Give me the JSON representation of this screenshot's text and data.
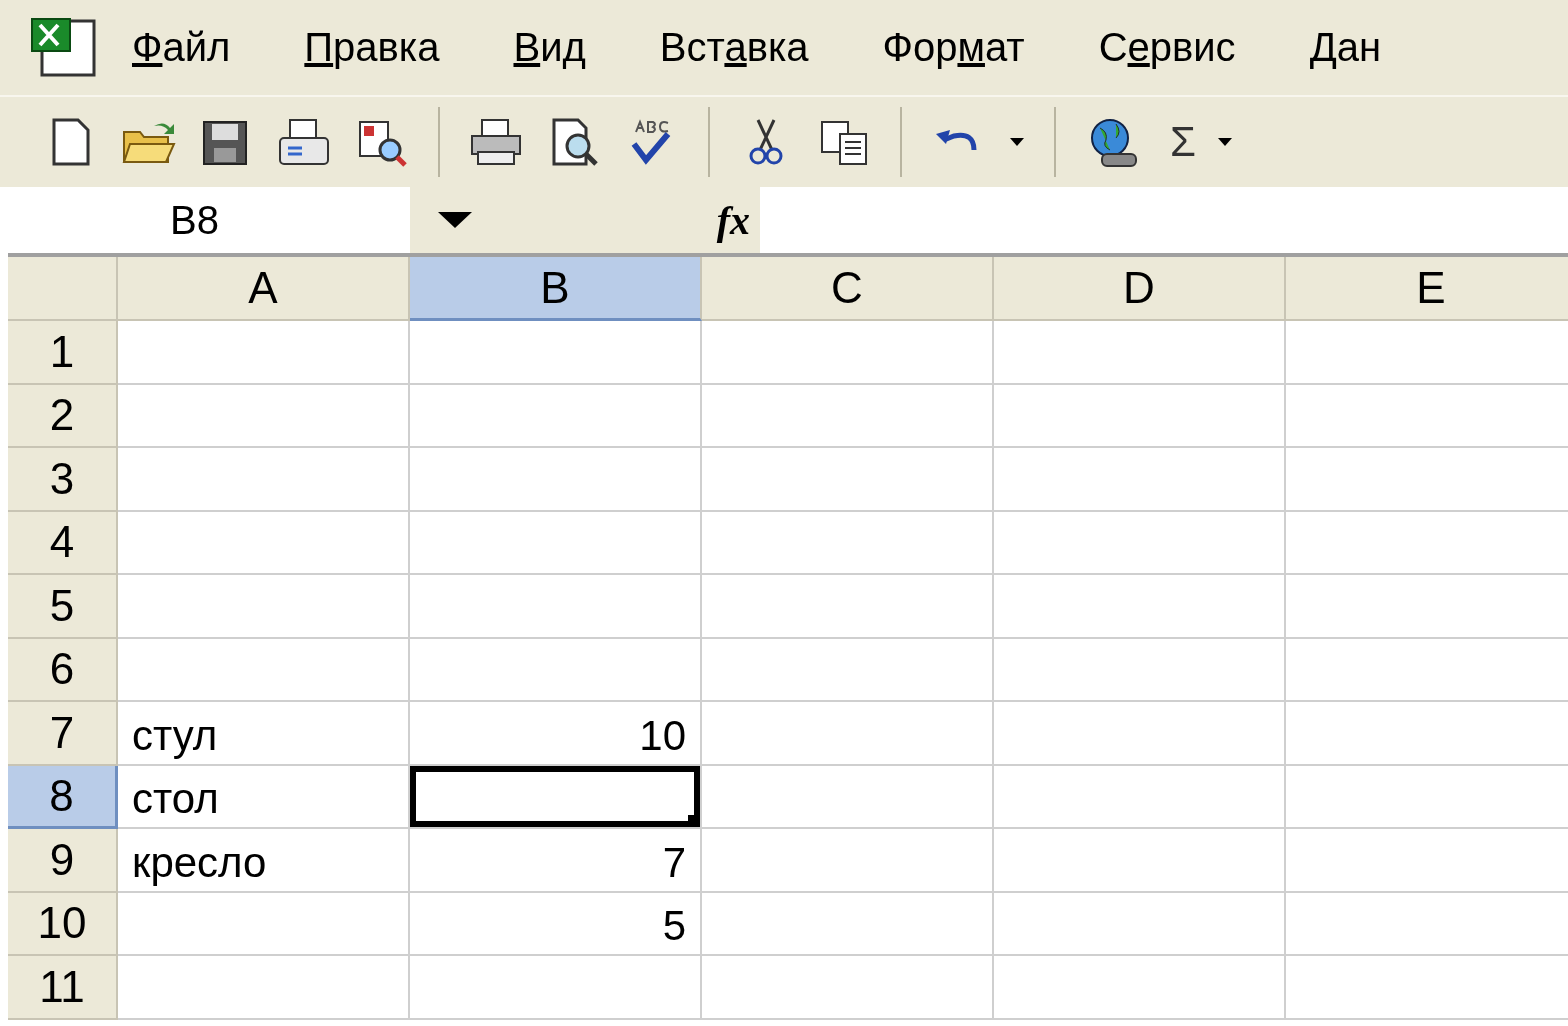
{
  "menu": [
    {
      "key": "Ф",
      "after": "айл"
    },
    {
      "key": "П",
      "after": "равка"
    },
    {
      "key": "В",
      "after": "ид"
    },
    {
      "before": "Вст",
      "key": "а",
      "after": "вка"
    },
    {
      "before": "Фор",
      "key": "м",
      "after": "ат"
    },
    {
      "before": "С",
      "key": "е",
      "after": "рвис"
    },
    {
      "before": "Дан"
    }
  ],
  "toolbar": [
    {
      "kind": "new"
    },
    {
      "kind": "open"
    },
    {
      "kind": "save"
    },
    {
      "kind": "mail"
    },
    {
      "kind": "research"
    },
    {
      "kind": "separator"
    },
    {
      "kind": "print"
    },
    {
      "kind": "preview"
    },
    {
      "kind": "spell"
    },
    {
      "kind": "separator"
    },
    {
      "kind": "cut"
    },
    {
      "kind": "copy"
    },
    {
      "kind": "separator"
    },
    {
      "kind": "undo"
    },
    {
      "kind": "caret"
    },
    {
      "kind": "separator"
    },
    {
      "kind": "globe"
    },
    {
      "kind": "sum",
      "text": "Σ"
    },
    {
      "kind": "caret"
    }
  ],
  "formula_bar": {
    "name_box": "B8",
    "fx": "fx"
  },
  "columns": [
    {
      "label": "A",
      "selected": false
    },
    {
      "label": "B",
      "selected": true
    },
    {
      "label": "C",
      "selected": false
    },
    {
      "label": "D",
      "selected": false
    },
    {
      "label": "E",
      "selected": false
    }
  ],
  "rows": [
    {
      "label": "1",
      "selected": false
    },
    {
      "label": "2",
      "selected": false
    },
    {
      "label": "3",
      "selected": false
    },
    {
      "label": "4",
      "selected": false
    },
    {
      "label": "5",
      "selected": false
    },
    {
      "label": "6",
      "selected": false
    },
    {
      "label": "7",
      "selected": false,
      "a": "стул",
      "b": "10"
    },
    {
      "label": "8",
      "selected": true,
      "a": "стол"
    },
    {
      "label": "9",
      "selected": false,
      "a": "кресло",
      "b": "7"
    },
    {
      "label": "10",
      "selected": false,
      "b": "5"
    },
    {
      "label": "11",
      "selected": false
    }
  ]
}
